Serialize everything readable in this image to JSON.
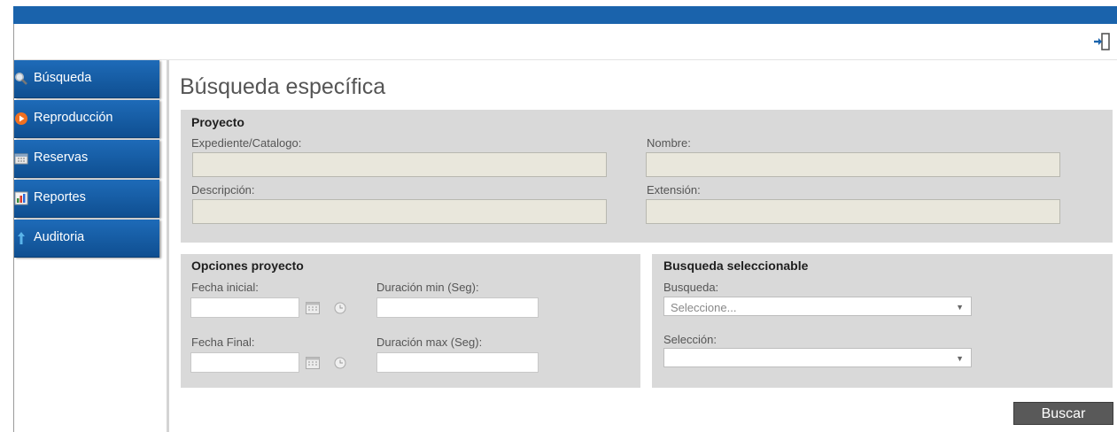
{
  "header": {
    "logout_icon": "logout-icon"
  },
  "sidebar": {
    "items": [
      {
        "label": "Búsqueda",
        "icon": "search-icon"
      },
      {
        "label": "Reproducción",
        "icon": "play-icon"
      },
      {
        "label": "Reservas",
        "icon": "calendar-icon"
      },
      {
        "label": "Reportes",
        "icon": "report-icon"
      },
      {
        "label": "Auditoria",
        "icon": "audit-icon"
      }
    ]
  },
  "main": {
    "title": "Búsqueda específica",
    "proyecto": {
      "title": "Proyecto",
      "expediente_label": "Expediente/Catalogo:",
      "nombre_label": "Nombre:",
      "descripcion_label": "Descripción:",
      "extension_label": "Extensión:"
    },
    "opciones": {
      "title": "Opciones proyecto",
      "fecha_inicial_label": "Fecha inicial:",
      "fecha_final_label": "Fecha Final:",
      "duracion_min_label": "Duración min (Seg):",
      "duracion_max_label": "Duración max (Seg):"
    },
    "seleccionable": {
      "title": "Busqueda seleccionable",
      "busqueda_label": "Busqueda:",
      "busqueda_value": "Seleccione...",
      "seleccion_label": "Selección:",
      "seleccion_value": ""
    },
    "buscar_label": "Buscar"
  },
  "colors": {
    "topbar": "#1a63ac",
    "nav": "#1565b5",
    "panel": "#d9d9d9",
    "button": "#595959"
  }
}
